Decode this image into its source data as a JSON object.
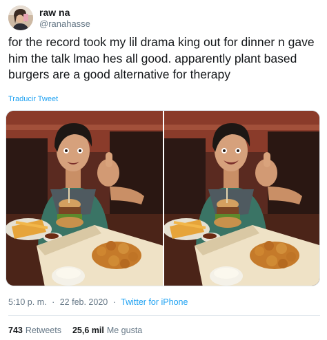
{
  "user": {
    "display_name": "raw na",
    "handle": "@ranahasse"
  },
  "tweet": {
    "text": "for the record took my lil drama king out for dinner n gave him the talk lmao hes all good. apparently plant based burgers are a good alternative for therapy",
    "translate_label": "Traducir Tweet",
    "photo_count": 2
  },
  "meta": {
    "time": "5:10 p. m.",
    "separator": "·",
    "date": "22 feb. 2020",
    "source": "Twitter for iPhone"
  },
  "stats": {
    "retweets_count": "743",
    "retweets_label": "Retweets",
    "likes_count": "25,6 mil",
    "likes_label": "Me gusta"
  },
  "colors": {
    "link": "#1da1f2",
    "secondary_text": "#657786",
    "primary_text": "#14171a"
  }
}
